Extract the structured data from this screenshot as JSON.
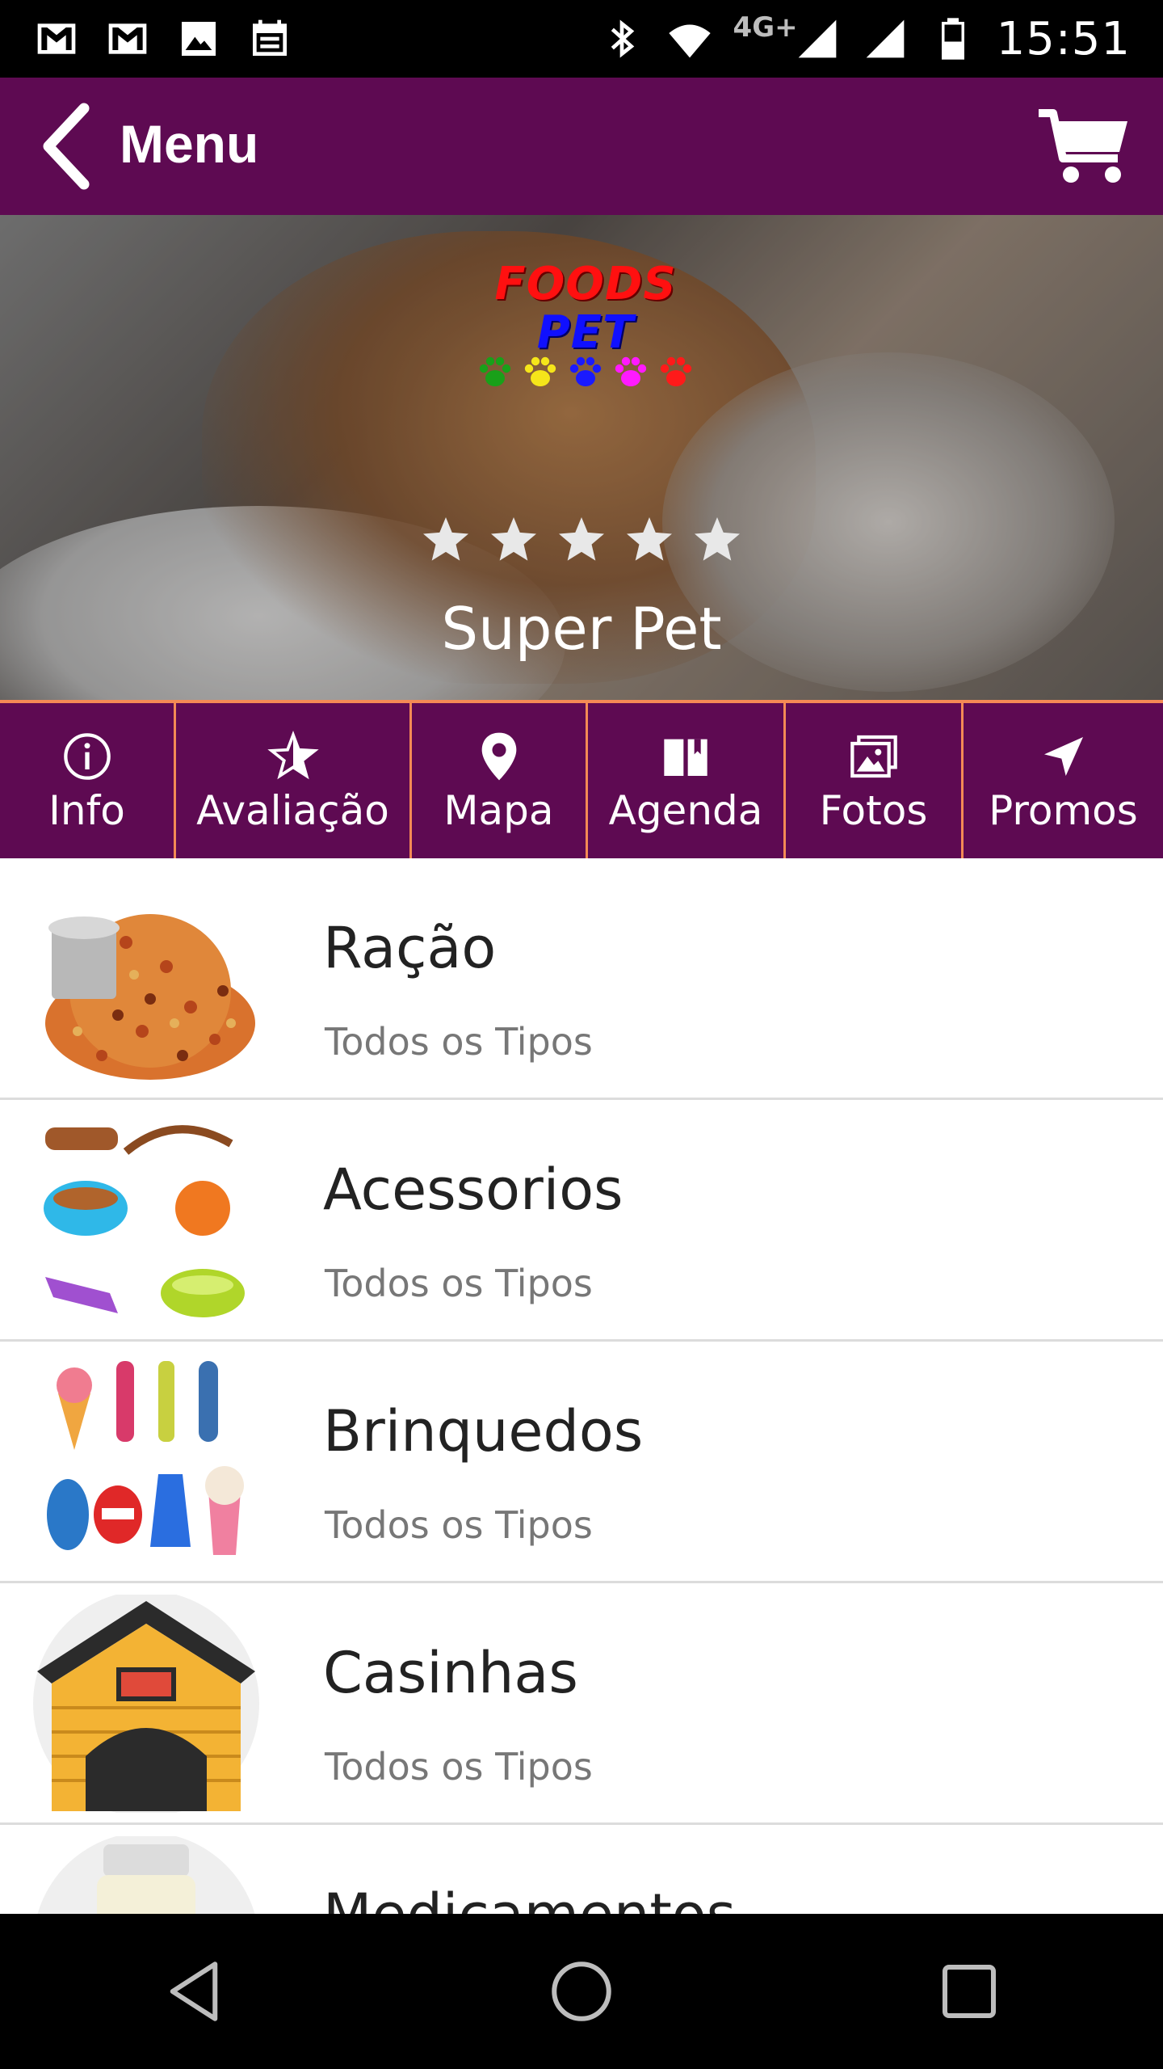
{
  "status_bar": {
    "time": "15:51",
    "network": "4G+",
    "left_icons": [
      "gmail-icon",
      "gmail-icon",
      "image-icon",
      "calendar-icon"
    ],
    "right_icons": [
      "bluetooth-icon",
      "wifi-icon",
      "signal-icon",
      "signal-icon",
      "battery-icon"
    ]
  },
  "app_bar": {
    "title": "Menu",
    "back_icon": "chevron-left-icon",
    "cart_icon": "cart-icon",
    "color": "#5e0a52"
  },
  "hero": {
    "logo_word1": "FOODS",
    "logo_word2": "PET",
    "paw_colors": [
      "#19a019",
      "#f5e51a",
      "#1a1aff",
      "#ff1aff",
      "#ff1a1a"
    ],
    "rating_stars": 5,
    "store_name": "Super Pet"
  },
  "tabs": [
    {
      "label": "Info",
      "icon": "info-icon"
    },
    {
      "label": "Avaliação",
      "icon": "star-icon"
    },
    {
      "label": "Mapa",
      "icon": "map-pin-icon"
    },
    {
      "label": "Agenda",
      "icon": "book-icon"
    },
    {
      "label": "Fotos",
      "icon": "photos-icon"
    },
    {
      "label": "Promos",
      "icon": "send-icon"
    }
  ],
  "accent_color": "#f48a55",
  "categories": [
    {
      "title": "Ração",
      "subtitle": "Todos os Tipos",
      "thumb": "pet-food-image"
    },
    {
      "title": "Acessorios",
      "subtitle": "Todos os Tipos",
      "thumb": "accessories-image"
    },
    {
      "title": "Brinquedos",
      "subtitle": "Todos os Tipos",
      "thumb": "toys-image"
    },
    {
      "title": "Casinhas",
      "subtitle": "Todos os Tipos",
      "thumb": "dog-house-image"
    },
    {
      "title": "Medicamentos",
      "subtitle": "",
      "thumb": "medicine-image"
    }
  ],
  "nav_bar": [
    "back-icon",
    "home-icon",
    "recents-icon"
  ]
}
